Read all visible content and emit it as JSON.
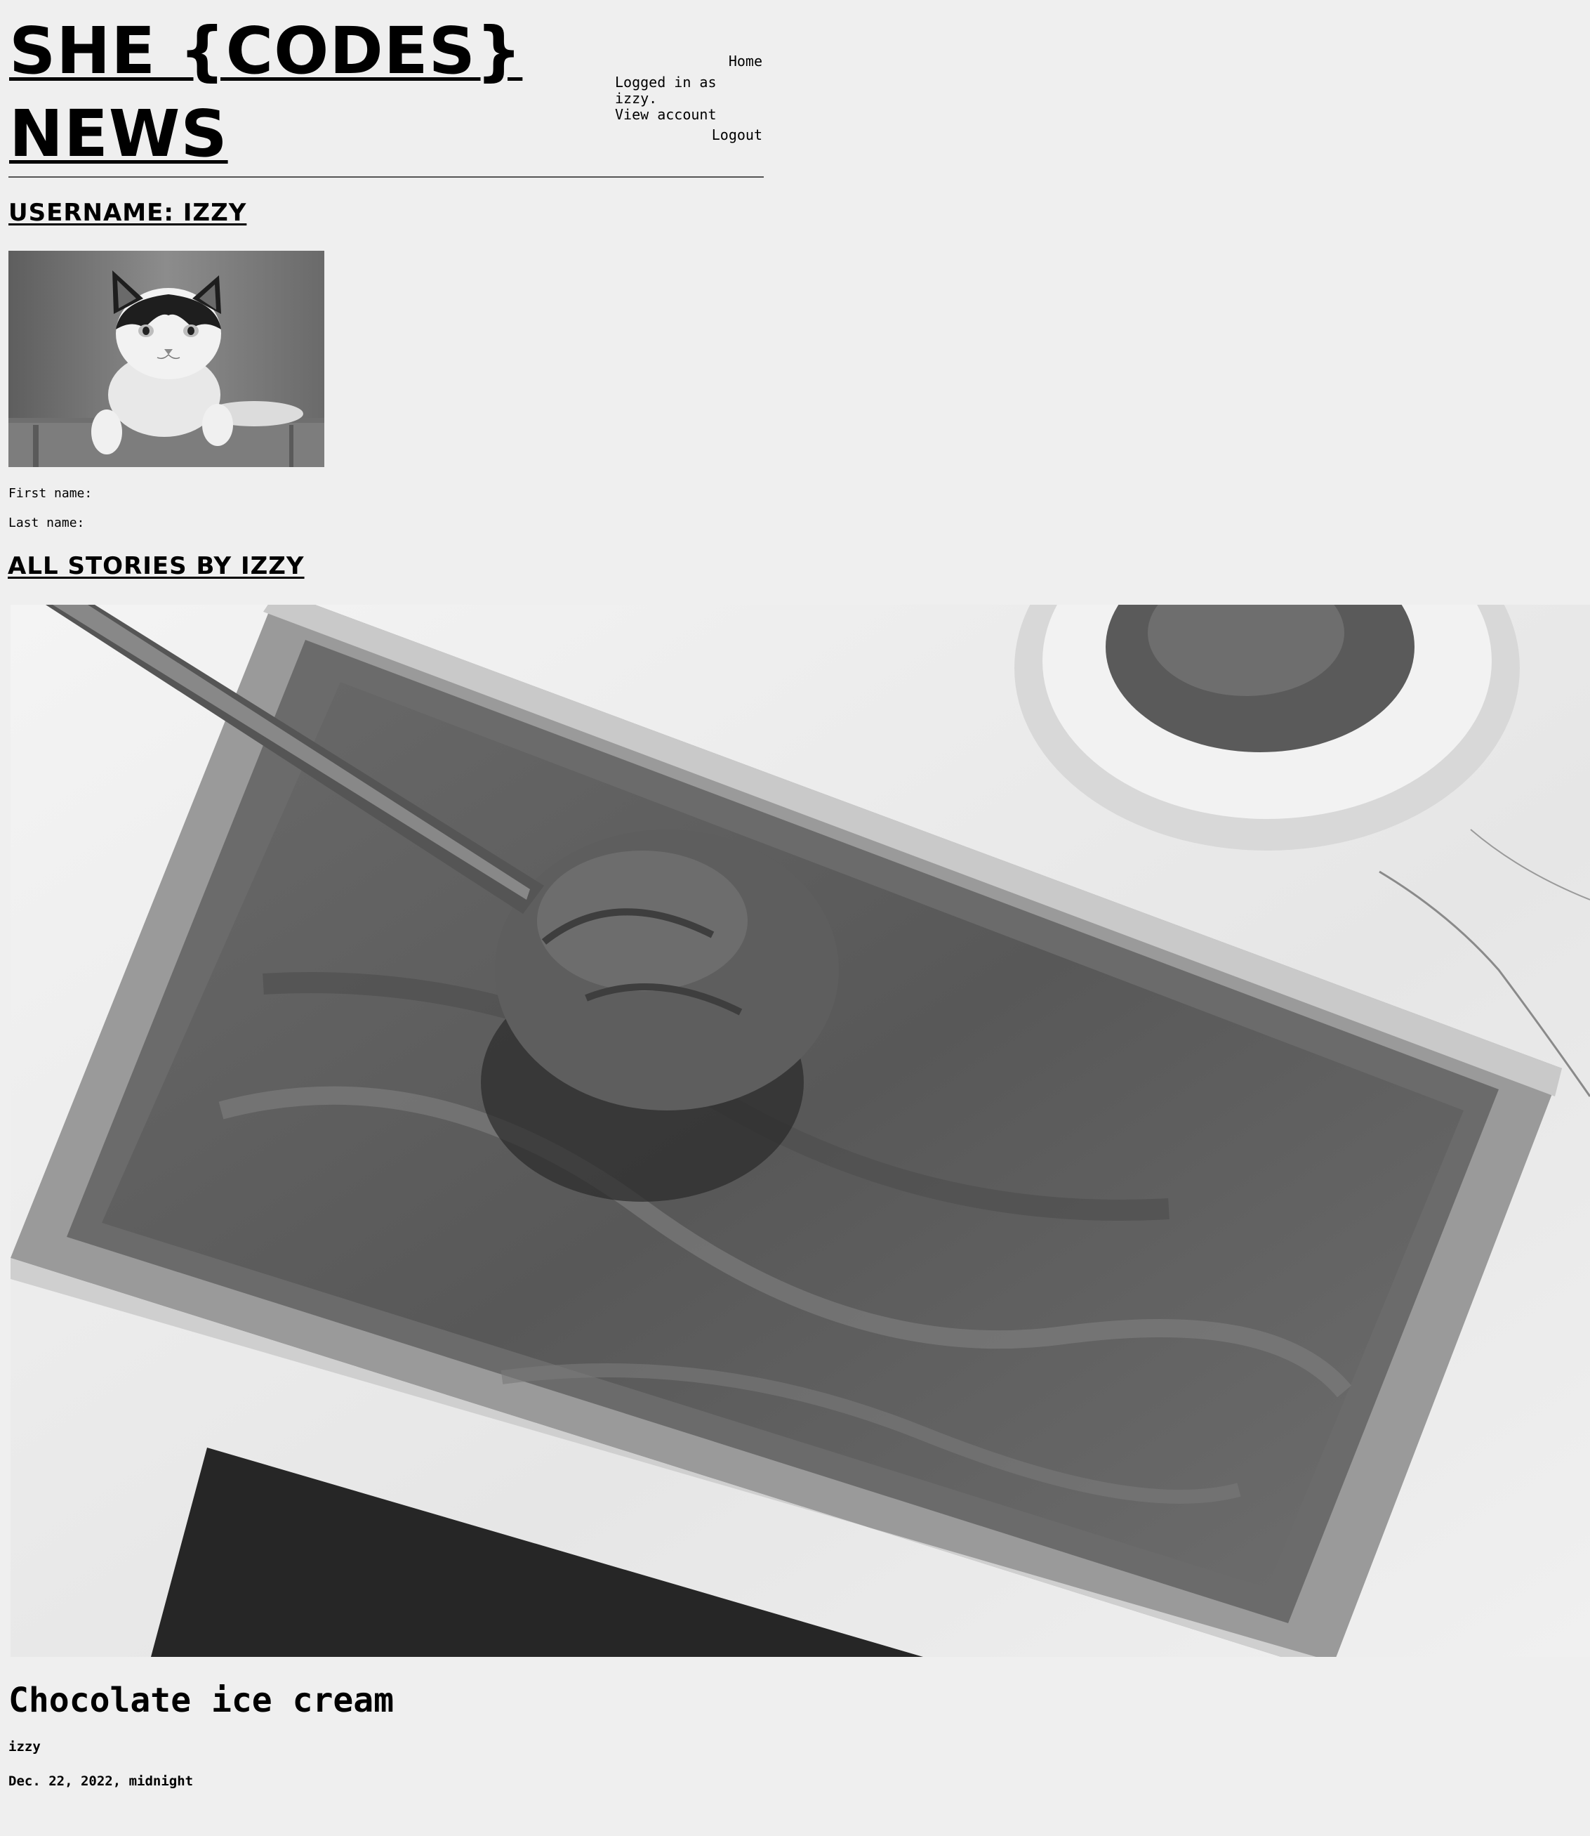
{
  "header": {
    "site_title_line1": "SHE {CODES}",
    "site_title_line2": "NEWS"
  },
  "nav": {
    "home": "Home",
    "logged_in": "Logged in as izzy.",
    "view_account": "View account",
    "logout": "Logout"
  },
  "profile": {
    "username_heading": "USERNAME: IZZY",
    "avatar_alt": "black and white cat peeking over a couch",
    "first_name_label": "First name:",
    "last_name_label": "Last name:"
  },
  "stories": {
    "heading": "ALL STORIES BY IZZY",
    "items": [
      {
        "image_alt": "chocolate ice cream in a metal loaf tin with a scoop",
        "title": "Chocolate ice cream",
        "author": "izzy",
        "date": "Dec. 22, 2022, midnight"
      }
    ]
  }
}
